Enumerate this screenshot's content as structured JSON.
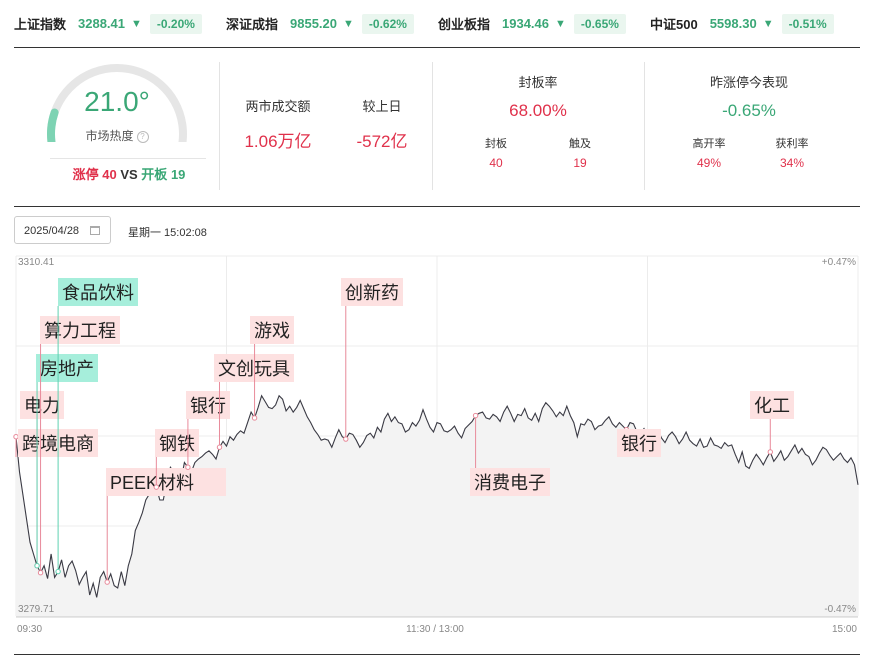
{
  "ticker": [
    {
      "name": "上证指数",
      "value": "3288.41",
      "change": "-0.20%"
    },
    {
      "name": "深证成指",
      "value": "9855.20",
      "change": "-0.62%"
    },
    {
      "name": "创业板指",
      "value": "1934.46",
      "change": "-0.65%"
    },
    {
      "name": "中证500",
      "value": "5598.30",
      "change": "-0.51%"
    }
  ],
  "heat": {
    "value": "21.0°",
    "label": "市场热度",
    "level": 0.21,
    "limit_up_label": "涨停",
    "limit_up_count": "40",
    "vs": "VS",
    "open_board_label": "开板",
    "open_board_count": "19"
  },
  "turnover": {
    "label": "两市成交额",
    "value": "1.06万亿",
    "prev_label": "较上日",
    "prev_value": "-572亿"
  },
  "seal": {
    "title": "封板率",
    "value": "68.00%",
    "sealed_label": "封板",
    "sealed_value": "40",
    "touched_label": "触及",
    "touched_value": "19"
  },
  "yesterday": {
    "title": "昨涨停今表现",
    "value": "-0.65%",
    "high_open_label": "高开率",
    "high_open_value": "49%",
    "profit_label": "获利率",
    "profit_value": "34%"
  },
  "date": "2025/04/28",
  "weekday_time": "星期一 15:02:08",
  "colors": {
    "up": "#e0314b",
    "down": "#3aa776",
    "tag_red": "#fde1e1",
    "tag_green": "#a6eedb"
  },
  "chart_data": {
    "type": "line",
    "ylim": [
      3279.71,
      3310.41
    ],
    "y_top_label": "3310.41",
    "y_bottom_label": "3279.71",
    "pct_top_label": "+0.47%",
    "pct_bottom_label": "-0.47%",
    "x_labels": [
      "09:30",
      "11:30 / 13:00",
      "15:00"
    ],
    "x_range": [
      0,
      240
    ],
    "series": [
      {
        "values": [
          [
            0,
            3295.0
          ],
          [
            1,
            3292.0
          ],
          [
            2,
            3290.0
          ],
          [
            3,
            3288.0
          ],
          [
            4,
            3286.0
          ],
          [
            5,
            3285.0
          ],
          [
            6,
            3284.0
          ],
          [
            7,
            3283.4
          ],
          [
            8,
            3284.0
          ],
          [
            9,
            3282.9
          ],
          [
            10,
            3285.0
          ],
          [
            11,
            3283.0
          ],
          [
            12,
            3283.5
          ],
          [
            13,
            3284.5
          ],
          [
            14,
            3283.0
          ],
          [
            15,
            3284.0
          ],
          [
            16,
            3284.4
          ],
          [
            17,
            3283.6
          ],
          [
            18,
            3282.4
          ],
          [
            19,
            3283.0
          ],
          [
            20,
            3283.5
          ],
          [
            21,
            3281.5
          ],
          [
            22,
            3282.5
          ],
          [
            23,
            3281.3
          ],
          [
            24,
            3283.0
          ],
          [
            25,
            3283.5
          ],
          [
            26,
            3282.6
          ],
          [
            27,
            3283.3
          ],
          [
            28,
            3282.3
          ],
          [
            29,
            3282.1
          ],
          [
            30,
            3283.5
          ],
          [
            31,
            3282.3
          ],
          [
            32,
            3284.0
          ],
          [
            33,
            3285.0
          ],
          [
            34,
            3287.0
          ],
          [
            35,
            3287.7
          ],
          [
            36,
            3288.5
          ],
          [
            37,
            3289.6
          ],
          [
            38,
            3290.1
          ],
          [
            39,
            3291.3
          ],
          [
            40,
            3290.7
          ],
          [
            41,
            3289.6
          ],
          [
            42,
            3289.6
          ],
          [
            43,
            3291.2
          ],
          [
            44,
            3292.4
          ],
          [
            45,
            3292.0
          ],
          [
            46,
            3292.1
          ],
          [
            47,
            3291.2
          ],
          [
            48,
            3292.8
          ],
          [
            49,
            3292.4
          ],
          [
            50,
            3292.0
          ],
          [
            51,
            3292.8
          ],
          [
            52,
            3293.1
          ],
          [
            53,
            3293.3
          ],
          [
            54,
            3293.6
          ],
          [
            55,
            3293.8
          ],
          [
            56,
            3293.5
          ],
          [
            57,
            3293.1
          ],
          [
            58,
            3294.1
          ],
          [
            59,
            3294.6
          ],
          [
            60,
            3294.2
          ],
          [
            61,
            3295.0
          ],
          [
            62,
            3294.7
          ],
          [
            63,
            3295.2
          ],
          [
            64,
            3295.5
          ],
          [
            65,
            3295.3
          ],
          [
            66,
            3296.2
          ],
          [
            67,
            3297.1
          ],
          [
            68,
            3296.6
          ],
          [
            69,
            3297.5
          ],
          [
            70,
            3298.5
          ],
          [
            71,
            3298.0
          ],
          [
            72,
            3297.5
          ],
          [
            73,
            3297.4
          ],
          [
            74,
            3297.7
          ],
          [
            75,
            3298.5
          ],
          [
            76,
            3298.2
          ],
          [
            77,
            3297.2
          ],
          [
            78,
            3297.6
          ],
          [
            79,
            3297.1
          ],
          [
            80,
            3297.5
          ],
          [
            81,
            3298.1
          ],
          [
            82,
            3297.4
          ],
          [
            83,
            3296.7
          ],
          [
            84,
            3296.2
          ],
          [
            85,
            3295.6
          ],
          [
            86,
            3295.2
          ],
          [
            87,
            3294.7
          ],
          [
            88,
            3294.8
          ],
          [
            89,
            3294.7
          ],
          [
            90,
            3294.1
          ],
          [
            91,
            3294.9
          ],
          [
            92,
            3295.6
          ],
          [
            93,
            3295.0
          ],
          [
            94,
            3294.8
          ],
          [
            95,
            3295.3
          ],
          [
            96,
            3295.2
          ],
          [
            97,
            3294.7
          ],
          [
            98,
            3294.1
          ],
          [
            99,
            3294.5
          ],
          [
            100,
            3295.1
          ],
          [
            101,
            3295.3
          ],
          [
            102,
            3294.9
          ],
          [
            103,
            3295.8
          ],
          [
            104,
            3295.4
          ],
          [
            105,
            3296.5
          ],
          [
            106,
            3297.0
          ],
          [
            107,
            3296.3
          ],
          [
            108,
            3296.7
          ],
          [
            109,
            3296.2
          ],
          [
            110,
            3296.1
          ],
          [
            111,
            3295.4
          ],
          [
            112,
            3295.6
          ],
          [
            113,
            3296.2
          ],
          [
            114,
            3295.9
          ],
          [
            115,
            3296.4
          ],
          [
            116,
            3297.3
          ],
          [
            117,
            3296.5
          ],
          [
            118,
            3295.8
          ],
          [
            119,
            3295.4
          ],
          [
            120,
            3296.2
          ],
          [
            121,
            3296.1
          ],
          [
            122,
            3295.5
          ],
          [
            123,
            3295.4
          ],
          [
            124,
            3295.6
          ],
          [
            125,
            3295.9
          ],
          [
            126,
            3295.3
          ],
          [
            127,
            3294.9
          ],
          [
            128,
            3295.7
          ],
          [
            129,
            3296.0
          ],
          [
            130,
            3296.3
          ],
          [
            131,
            3296.8
          ],
          [
            132,
            3297.0
          ],
          [
            133,
            3297.1
          ],
          [
            134,
            3296.6
          ],
          [
            135,
            3296.5
          ],
          [
            136,
            3296.9
          ],
          [
            137,
            3296.7
          ],
          [
            138,
            3296.3
          ],
          [
            139,
            3297.1
          ],
          [
            140,
            3297.6
          ],
          [
            141,
            3297.0
          ],
          [
            142,
            3296.3
          ],
          [
            143,
            3296.9
          ],
          [
            144,
            3296.8
          ],
          [
            145,
            3297.4
          ],
          [
            146,
            3296.6
          ],
          [
            147,
            3296.4
          ],
          [
            148,
            3297.0
          ],
          [
            149,
            3296.3
          ],
          [
            150,
            3297.4
          ],
          [
            151,
            3297.9
          ],
          [
            152,
            3297.6
          ],
          [
            153,
            3297.2
          ],
          [
            154,
            3296.7
          ],
          [
            155,
            3297.1
          ],
          [
            156,
            3296.8
          ],
          [
            157,
            3297.6
          ],
          [
            158,
            3296.8
          ],
          [
            159,
            3296.2
          ],
          [
            160,
            3295.0
          ],
          [
            161,
            3296.1
          ],
          [
            162,
            3296.0
          ],
          [
            163,
            3296.5
          ],
          [
            164,
            3296.3
          ],
          [
            165,
            3295.6
          ],
          [
            166,
            3295.9
          ],
          [
            167,
            3296.0
          ],
          [
            168,
            3296.4
          ],
          [
            169,
            3296.7
          ],
          [
            170,
            3296.1
          ],
          [
            171,
            3295.8
          ],
          [
            172,
            3296.2
          ],
          [
            173,
            3295.9
          ],
          [
            174,
            3295.6
          ],
          [
            175,
            3296.2
          ],
          [
            176,
            3296.1
          ],
          [
            177,
            3295.4
          ],
          [
            178,
            3295.3
          ],
          [
            179,
            3295.7
          ],
          [
            180,
            3295.1
          ],
          [
            181,
            3294.6
          ],
          [
            182,
            3295.0
          ],
          [
            183,
            3295.5
          ],
          [
            184,
            3294.9
          ],
          [
            185,
            3294.5
          ],
          [
            186,
            3295.1
          ],
          [
            187,
            3295.4
          ],
          [
            188,
            3295.0
          ],
          [
            189,
            3294.4
          ],
          [
            190,
            3294.8
          ],
          [
            191,
            3295.4
          ],
          [
            192,
            3294.7
          ],
          [
            193,
            3294.4
          ],
          [
            194,
            3294.2
          ],
          [
            195,
            3294.8
          ],
          [
            196,
            3294.1
          ],
          [
            197,
            3294.2
          ],
          [
            198,
            3294.9
          ],
          [
            199,
            3294.3
          ],
          [
            200,
            3294.2
          ],
          [
            201,
            3294.0
          ],
          [
            202,
            3294.5
          ],
          [
            203,
            3294.2
          ],
          [
            204,
            3294.3
          ],
          [
            205,
            3293.5
          ],
          [
            206,
            3292.8
          ],
          [
            207,
            3293.7
          ],
          [
            208,
            3292.5
          ],
          [
            209,
            3292.3
          ],
          [
            210,
            3293.0
          ],
          [
            211,
            3293.5
          ],
          [
            212,
            3293.1
          ],
          [
            213,
            3292.6
          ],
          [
            214,
            3293.2
          ],
          [
            215,
            3293.7
          ],
          [
            216,
            3292.9
          ],
          [
            217,
            3293.3
          ],
          [
            218,
            3293.8
          ],
          [
            219,
            3293.0
          ],
          [
            220,
            3293.3
          ],
          [
            221,
            3293.8
          ],
          [
            222,
            3294.3
          ],
          [
            223,
            3293.6
          ],
          [
            224,
            3294.0
          ],
          [
            225,
            3293.5
          ],
          [
            226,
            3293.3
          ],
          [
            227,
            3292.6
          ],
          [
            228,
            3293.0
          ],
          [
            229,
            3293.6
          ],
          [
            230,
            3294.1
          ],
          [
            231,
            3293.9
          ],
          [
            232,
            3293.4
          ],
          [
            233,
            3293.0
          ],
          [
            234,
            3293.3
          ],
          [
            235,
            3293.6
          ],
          [
            236,
            3293.1
          ],
          [
            237,
            3292.8
          ],
          [
            238,
            3293.2
          ],
          [
            239,
            3292.6
          ],
          [
            240,
            3290.9
          ]
        ]
      }
    ],
    "annotations": [
      {
        "label": "跨境电商",
        "x": 0,
        "color": "red"
      },
      {
        "label": "电力",
        "x": 6,
        "color": "red"
      },
      {
        "label": "房地产",
        "x": 6,
        "color": "green"
      },
      {
        "label": "算力工程",
        "x": 7,
        "color": "red"
      },
      {
        "label": "食品饮料",
        "x": 12,
        "color": "green"
      },
      {
        "label": "PEEK材料",
        "x": 26,
        "color": "red"
      },
      {
        "label": "钢铁",
        "x": 40,
        "color": "red"
      },
      {
        "label": "银行",
        "x": 49,
        "color": "red"
      },
      {
        "label": "文创玩具",
        "x": 58,
        "color": "red"
      },
      {
        "label": "游戏",
        "x": 68,
        "color": "red"
      },
      {
        "label": "创新药",
        "x": 94,
        "color": "red"
      },
      {
        "label": "消费电子",
        "x": 131,
        "color": "red"
      },
      {
        "label": "银行",
        "x": 174,
        "color": "red"
      },
      {
        "label": "化工",
        "x": 215,
        "color": "red"
      }
    ]
  }
}
